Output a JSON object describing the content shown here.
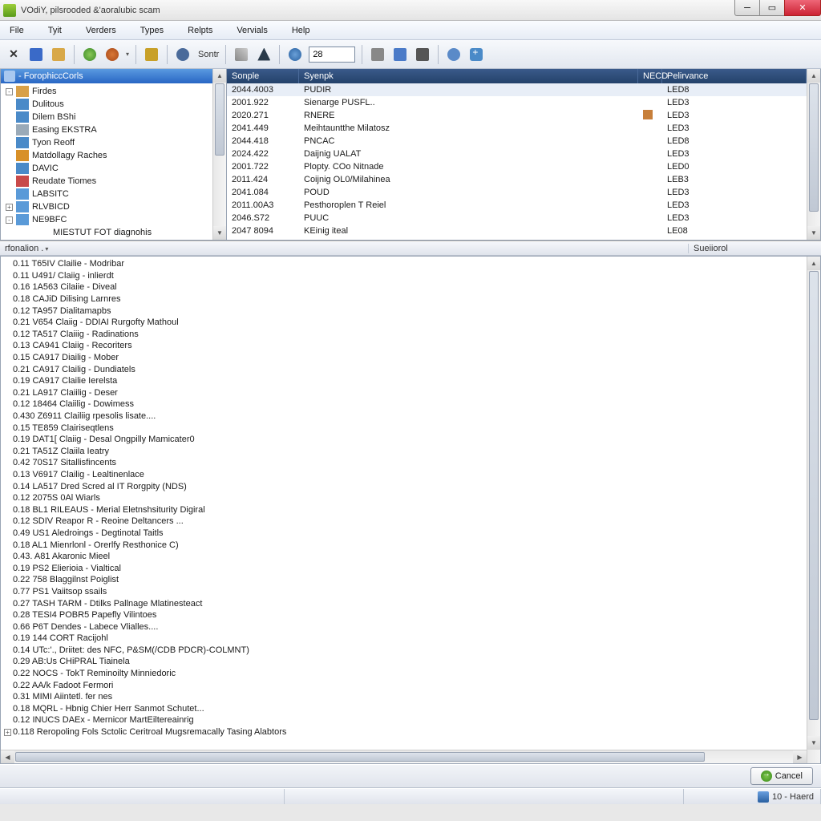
{
  "window": {
    "title": "VOdiY, pilsrooded &'aoralubic scam"
  },
  "menu": [
    "File",
    "Tyit",
    "Verders",
    "Types",
    "Relpts",
    "Vervials",
    "Help"
  ],
  "toolbar": {
    "sort_label": "Sontr",
    "search_value": "28"
  },
  "tree": {
    "header": "-  ForophiccCorls",
    "items": [
      {
        "exp": "-",
        "icon": "#d8a048",
        "label": "Firdes"
      },
      {
        "exp": "",
        "icon": "#4a8ac8",
        "label": "Dulitous"
      },
      {
        "exp": "",
        "icon": "#4a8ac8",
        "label": "Dilem BShi"
      },
      {
        "exp": "",
        "icon": "#9aaab8",
        "label": "Easing EKSTRA"
      },
      {
        "exp": "",
        "icon": "#4a8ac8",
        "label": "Tyon Reoff"
      },
      {
        "exp": "",
        "icon": "#d89028",
        "label": "Matdollagy Raches"
      },
      {
        "exp": "",
        "icon": "#4a8ac8",
        "label": "DAVIC"
      },
      {
        "exp": "",
        "icon": "#c84a4a",
        "label": "Reudate Tiomes"
      },
      {
        "exp": "",
        "icon": "#5a9ad8",
        "label": "LABSITC"
      },
      {
        "exp": "+",
        "icon": "#5a9ad8",
        "label": "RLVBICD"
      },
      {
        "exp": "-",
        "icon": "#5a9ad8",
        "label": "NE9BFC"
      },
      {
        "exp": "",
        "icon": "",
        "label": "MIESTUT FOT diagnohis",
        "indent": true
      }
    ]
  },
  "table": {
    "headers": [
      "Sonple",
      "Syenpk",
      "NECD",
      "Pelirvance"
    ],
    "rows": [
      {
        "c1": "2044.4003",
        "c2": "PUDIR",
        "flag": false,
        "c4": "LED8",
        "sel": true
      },
      {
        "c1": "2001.922",
        "c2": "Sienarge PUSFL..",
        "flag": false,
        "c4": "LED3"
      },
      {
        "c1": "2020.271",
        "c2": "RNERE",
        "flag": true,
        "c4": "LED3"
      },
      {
        "c1": "2041.449",
        "c2": "Meihtauntthe Milatosz",
        "flag": false,
        "c4": "LED3"
      },
      {
        "c1": "2044.418",
        "c2": "PNCAC",
        "flag": false,
        "c4": "LED8"
      },
      {
        "c1": "2024.422",
        "c2": "Daijnig UALAT",
        "flag": false,
        "c4": "LED3"
      },
      {
        "c1": "2001.722",
        "c2": "Plopty. COo Nitnade",
        "flag": false,
        "c4": "LED0"
      },
      {
        "c1": "2011.424",
        "c2": "Coijnig OL0/Milahinea",
        "flag": false,
        "c4": "LEB3"
      },
      {
        "c1": "2041.084",
        "c2": "POUD",
        "flag": false,
        "c4": "LED3"
      },
      {
        "c1": "2011.00A3",
        "c2": "Pesthoroplen T Reiel",
        "flag": false,
        "c4": "LED3"
      },
      {
        "c1": "2046.S72",
        "c2": "PUUC",
        "flag": false,
        "c4": "LED3"
      },
      {
        "c1": "2047 8094",
        "c2": "KEinig iteal",
        "flag": false,
        "c4": "LE08"
      }
    ]
  },
  "infobar": {
    "left": "rfonalion .",
    "right": "Sueiiorol"
  },
  "list": [
    "0.11 T65IV Clailie - Modribar",
    "0.11 U491/ Claiig - inlierdt",
    "0.16 1A563 Cilaiie - Diveal",
    "0.18 CAJiD Dilising Larnres",
    "0.12 TA957 Dialitamapbs",
    "0.21 V654 Claiig - DDIAI Rurgofty Mathoul",
    "0.12 TA517 Claiiig - Radinations",
    "0.13 CA941 Claiig - Recoriters",
    "0.15 CA917 Diailig - Mober",
    "0.21 CA917 Clailig - Dundiatels",
    "0.19 CA917 Clailie Ierelsta",
    "0.21 LA917 Claiilig - Deser",
    "0.12 18464 Claiilig - Dowimess",
    "0.430 Z6911 Clailiig rpesolis lisate....",
    "0.15 TE859 Clairiseqtlens",
    "0.19 DAT1[ Claiig - Desal Ongpilly Mamicater0",
    "0.21 TA51Z Claiila Ieatry",
    "0.42 70S17 Sitallisfincents",
    "0.13 V6917 Clailig - Lealtinenlace",
    "0.14 LA517 Dred Scred al IT Rorgpity (NDS)",
    "0.12 2075S 0Al Wiarls",
    "0.18 BL1 RILEAUS - Merial Eletnshsiturity Digiral",
    "0.12 SDIV Reapor R - Reoine Deltancers ...",
    "0.49 US1 Aledroings - Degtinotal Taitls",
    "0.18 AL1 Mienrlonl - Orerlfy Resthonice C)",
    "0.43. A81 Akaronic Mieel",
    "0.19 PS2 Elierioia - Vialtical",
    "0.22 758 Blaggilnst Poiglist",
    "0.77 PS1 Vaiitsop ssails",
    "0.27 TASH TARM - Dtilks Pallnage Mlatinesteact",
    "0.28 TESI4 POBR5   Papefly Vilintoes",
    "0.66 P6T Dendes - Labece Vlialles....",
    "0.19 144 CORT Racijohl",
    "0.14 UTc:'., Driitet: des NFC, P&SM(/CDB PDCR)-COLMNT)",
    "0.29 AB:Us CHiPRAL Tiainela",
    "0.22 NOCS - TokT Reminoilty Minniedoric",
    "0.22 AA/k Fadoot Fermori",
    "0.31 MIMI Aiintetl. fer nes",
    "0.18 MQRL - Hbnig Chier Herr Sanmot Schutet...",
    "0.12 INUCS DAEx - Mernicor MartEiltereainrig",
    "0.118 Reropoling Fols Sctolic Ceritroal Mugsremacally Tasing Alabtors"
  ],
  "list_expand_last": "+",
  "buttons": {
    "cancel": "Cancel"
  },
  "status": {
    "right": "10 - Haerd"
  }
}
